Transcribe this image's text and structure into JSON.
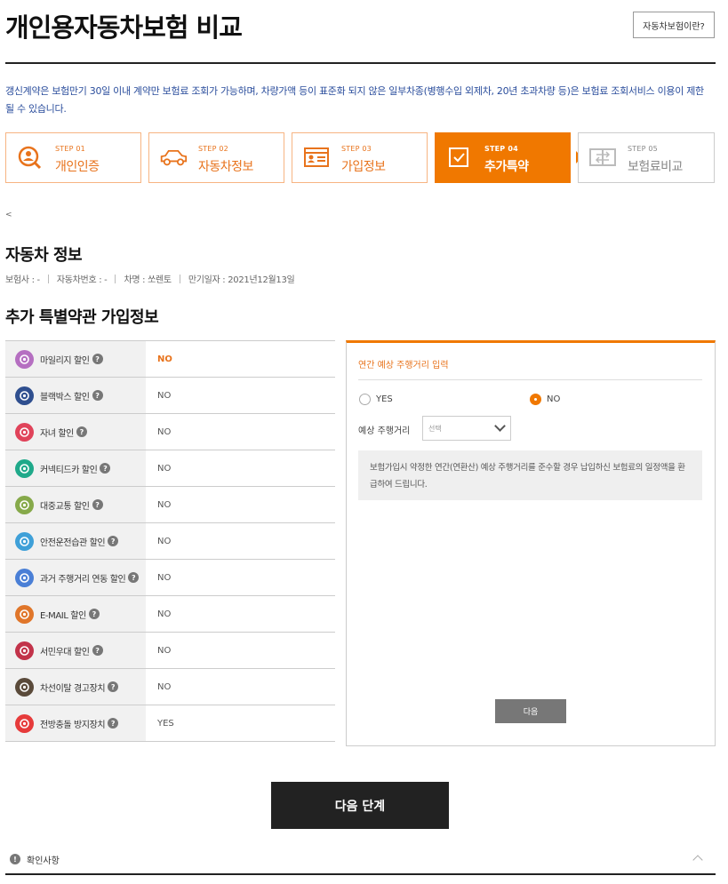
{
  "header": {
    "title": "개인용자동차보험 비교",
    "about_button": "자동차보험이란?"
  },
  "notice": "갱신계약은 보험만기 30일 이내 계약만 보험료 조회가 가능하며, 차량가액 등이 표준화 되지 않은 일부차종(병행수입 외제차, 20년 초과차량 등)은 보험료 조회서비스 이용이 제한 될 수 있습니다.",
  "steps": [
    {
      "step": "STEP 01",
      "label": "개인인증",
      "icon": "user-search-icon",
      "state": "done"
    },
    {
      "step": "STEP 02",
      "label": "자동차정보",
      "icon": "car-icon",
      "state": "done"
    },
    {
      "step": "STEP 03",
      "label": "가입정보",
      "icon": "id-card-icon",
      "state": "done"
    },
    {
      "step": "STEP 04",
      "label": "추가특약",
      "icon": "checkbox-icon",
      "state": "active"
    },
    {
      "step": "STEP 05",
      "label": "보험료비교",
      "icon": "compare-icon",
      "state": "disabled"
    }
  ],
  "tiny_mark": "<",
  "car_section": {
    "title": "자동차 정보",
    "insurer": "보험사 : -",
    "car_number": "자동차번호 : -",
    "car_name": "차명 : 쏘렌토",
    "expiry": "만기일자 : 2021년12월13일"
  },
  "discount_section": {
    "title": "추가 특별약관 가입정보",
    "items": [
      {
        "name": "마일리지 할인",
        "value": "NO",
        "icon": "mileage-icon",
        "color": "#b56fc1",
        "highlight": true
      },
      {
        "name": "블랙박스 할인",
        "value": "NO",
        "icon": "blackbox-icon",
        "color": "#2f4f8f",
        "highlight": false
      },
      {
        "name": "자녀 할인",
        "value": "NO",
        "icon": "child-icon",
        "color": "#e0435a",
        "highlight": false
      },
      {
        "name": "커넥티드카 할인",
        "value": "NO",
        "icon": "connected-car-icon",
        "color": "#1fa98a",
        "highlight": false
      },
      {
        "name": "대중교통 할인",
        "value": "NO",
        "icon": "bus-icon",
        "color": "#86a94a",
        "highlight": false
      },
      {
        "name": "안전운전습관 할인",
        "value": "NO",
        "icon": "safe-driving-icon",
        "color": "#3fa0d8",
        "highlight": false
      },
      {
        "name": "과거 주행거리 연동 할인",
        "value": "NO",
        "icon": "odometer-icon",
        "color": "#4a7fd6",
        "highlight": false
      },
      {
        "name": "E-MAIL 할인",
        "value": "NO",
        "icon": "email-icon",
        "color": "#e0762a",
        "highlight": false
      },
      {
        "name": "서민우대 할인",
        "value": "NO",
        "icon": "store-icon",
        "color": "#c2334a",
        "highlight": false
      },
      {
        "name": "차선이탈 경고장치",
        "value": "NO",
        "icon": "lane-warning-icon",
        "color": "#5a4a3a",
        "highlight": false
      },
      {
        "name": "전방충돌 방지장치",
        "value": "YES",
        "icon": "collision-icon",
        "color": "#e63b3b",
        "highlight": false
      }
    ]
  },
  "panel": {
    "title": "연간 예상 주행거리 입력",
    "yes_label": "YES",
    "no_label": "NO",
    "selected": "NO",
    "distance_label": "예상 주행거리",
    "select_value": "선택",
    "info": "보험가입시 약정한 연간(연환산) 예상 주행거리를 준수할 경우 납입하신 보험료의 일정액을 환급하여 드립니다.",
    "next_button": "다음"
  },
  "next_step_button": "다음 단계",
  "confirm": {
    "label": "확인사항"
  },
  "colors": {
    "accent": "#f07800",
    "notice": "#2a4d9c"
  }
}
